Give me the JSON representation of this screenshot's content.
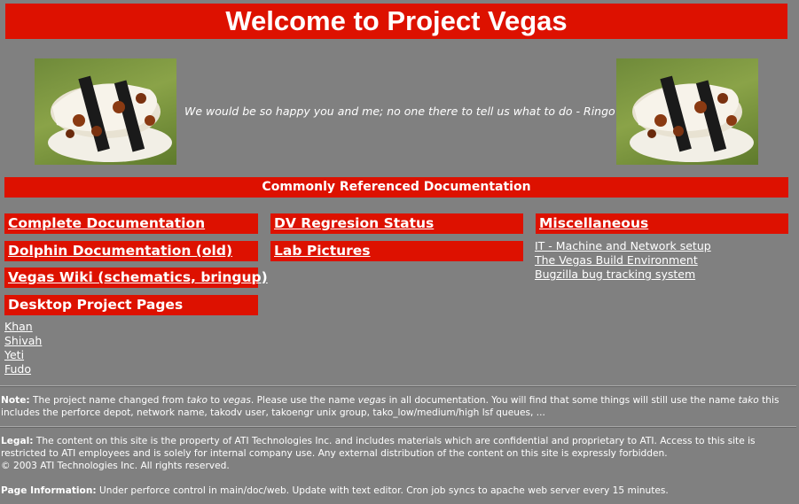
{
  "header": {
    "title": "Welcome to Project Vegas"
  },
  "banner": {
    "quote": "We would be so happy you and me; no one there to tell us what to do - Ringo Star",
    "left_image": "tako-sushi-image",
    "right_image": "tako-sushi-image"
  },
  "section": {
    "title": "Commonly Referenced Documentation"
  },
  "columns": {
    "col1": {
      "complete_docs": "Complete Documentation",
      "dolphin_docs": "Dolphin Documentation (old)",
      "wiki": "Vegas Wiki (schematics, bringup)",
      "desktop": "Desktop Project Pages",
      "desktop_links": [
        "Khan",
        "Shivah",
        "Yeti",
        "Fudo"
      ]
    },
    "col2": {
      "dv_status": "DV Regresion Status",
      "lab_pictures": "Lab Pictures"
    },
    "col3": {
      "misc": "Miscellaneous",
      "misc_links": [
        "IT - Machine and Network setup",
        "The Vegas Build Environment",
        "Bugzilla bug tracking system"
      ]
    }
  },
  "note": {
    "label": "Note:",
    "text_1": " The project name changed from ",
    "old_name": "tako",
    "text_2": " to ",
    "new_name": "vegas",
    "text_3": ". Please use the name ",
    "new_name_2": "vegas",
    "text_4": " in all documentation. You will find that some things will still use the name ",
    "old_name_2": "tako",
    "text_5": " this includes the perforce depot, network name, takodv user, takoengr unix group, tako_low/medium/high lsf queues, ..."
  },
  "legal": {
    "label": "Legal:",
    "text": " The content on this site is the property of ATI Technologies Inc. and includes materials which are confidential and proprietary to ATI. Access to this site is restricted to ATI employees and is solely for internal company use. Any external distribution of the content on this site is expressly forbidden.",
    "copyright": "© 2003 ATI Technologies Inc. All rights reserved."
  },
  "page_info": {
    "label": "Page Information:",
    "text": " Under perforce control in main/doc/web. Update with text editor. Cron job syncs to apache web server every 15 minutes."
  }
}
